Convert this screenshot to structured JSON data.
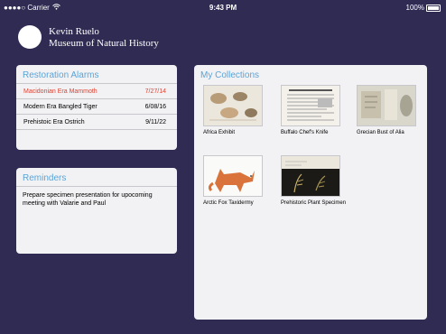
{
  "status_bar": {
    "carrier": "●●●●○ Carrier",
    "time": "9:43 PM",
    "battery": "100%"
  },
  "user": {
    "name": "Kevin Ruelo",
    "museum": "Museum of Natural History"
  },
  "alarms": {
    "title": "Restoration Alarms",
    "rows": [
      {
        "name": "Macidonian Era Mammoth",
        "date": "7/27/14"
      },
      {
        "name": "Modern Era Bangled Tiger",
        "date": "6/08/16"
      },
      {
        "name": "Prehistoic Era Ostrich",
        "date": "9/11/22"
      }
    ]
  },
  "reminders": {
    "title": "Reminders",
    "text": "Prepare specimen presentation for upocoming meeting with Valarie and Paul"
  },
  "collections": {
    "title": "My Collections",
    "items": [
      {
        "label": "Africa Exhibit"
      },
      {
        "label": "Buffalo Chef's Knife"
      },
      {
        "label": "Grecian Bust of Alia"
      },
      {
        "label": "Arctic Fox Taxidermy"
      },
      {
        "label": "Prehistoric Plant Specimen"
      }
    ]
  },
  "colors": {
    "background": "#2f2b52",
    "accent": "#5aa4d8",
    "alert": "#e0402f"
  }
}
